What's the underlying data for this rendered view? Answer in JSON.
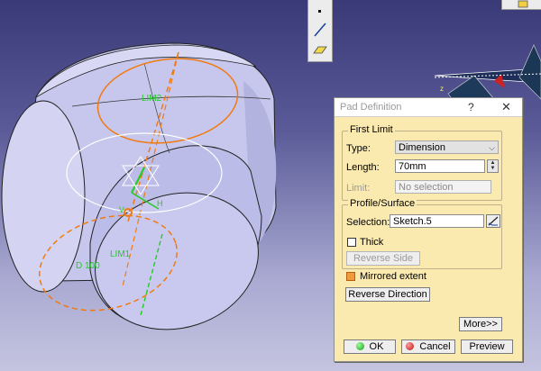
{
  "dialog": {
    "title": "Pad Definition",
    "help": "?",
    "close": "✕",
    "first_limit": {
      "legend": "First Limit",
      "type_label": "Type:",
      "type_value": "Dimension",
      "length_label": "Length:",
      "length_value": "70mm",
      "limit_label": "Limit:",
      "limit_value": "No selection"
    },
    "profile": {
      "legend": "Profile/Surface",
      "selection_label": "Selection:",
      "selection_value": "Sketch.5",
      "thick_label": "Thick",
      "thick_checked": false,
      "reverse_side_label": "Reverse Side"
    },
    "mirrored_label": "Mirrored extent",
    "mirrored_checked": true,
    "reverse_direction_label": "Reverse Direction",
    "more_label": "More>>",
    "ok_label": "OK",
    "cancel_label": "Cancel",
    "preview_label": "Preview"
  },
  "viewport": {
    "lim2": "LIM2",
    "lim1": "LIM1",
    "dimension": "D 100",
    "axis_h": "H",
    "axis_v": "V",
    "axis_z": "z"
  },
  "colors": {
    "dialog_bg": "#fbeab0",
    "solid_face": "#c9c9ee",
    "orange": "#f07a10",
    "green": "#22cc22"
  }
}
